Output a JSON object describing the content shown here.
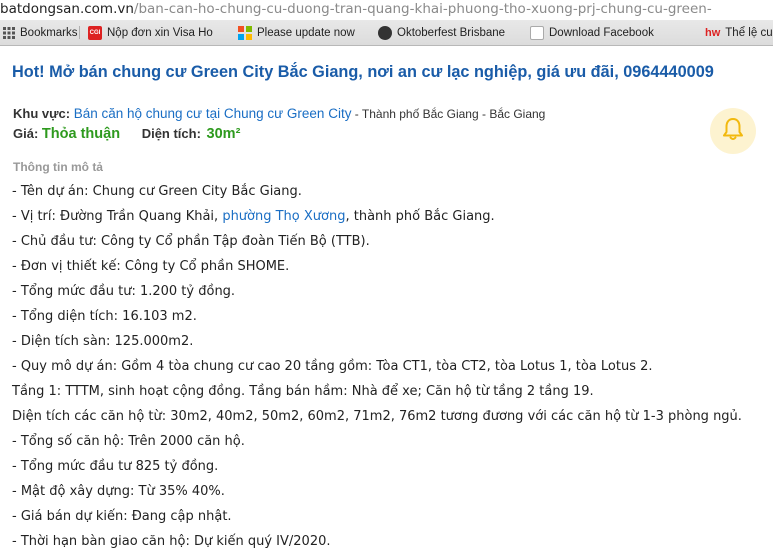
{
  "url": {
    "domain": "batdongsan.com.vn",
    "path": "/ban-can-ho-chung-cu-duong-tran-quang-khai-phuong-tho-xuong-prj-chung-cu-green-"
  },
  "bookmarks": [
    {
      "label": "Bookmarks",
      "icon": "grid-icon"
    },
    {
      "label": "Nộp đơn xin Visa Ho",
      "icon": "cgi-icon"
    },
    {
      "label": "Please update now",
      "icon": "windows-icon"
    },
    {
      "label": "Oktoberfest Brisbane",
      "icon": "oktoberfest-icon"
    },
    {
      "label": "Download Facebook",
      "icon": "facebook-download-icon"
    },
    {
      "label": "Thể lệ cu",
      "icon": "hw-icon"
    }
  ],
  "listing": {
    "title": "Hot! Mở bán chung cư Green City Bắc Giang, nơi an cư lạc nghiệp, giá ưu đãi, 0964440009",
    "area_label": "Khu vực:",
    "area_link": "Bán căn hộ chung cư tại Chung cư Green City",
    "area_rest": " - Thành phố Bắc Giang - Bắc Giang",
    "price_label": "Giá:",
    "price_value": "Thỏa thuận",
    "size_label": "Diện tích:",
    "size_value": "30m²",
    "section_heading": "Thông tin mô tả"
  },
  "description": {
    "lines": [
      {
        "text": "- Tên dự án: Chung cư Green City Bắc Giang."
      },
      {
        "before": "- Vị trí: Đường Trần Quang Khải, ",
        "link": "phường Thọ Xương",
        "after": ", thành phố Bắc Giang."
      },
      {
        "text": "- Chủ đầu tư: Công ty Cổ phần Tập đoàn Tiến Bộ (TTB)."
      },
      {
        "text": "- Đơn vị thiết kế: Công ty Cổ phần SHOME."
      },
      {
        "text": "- Tổng mức đầu tư: 1.200 tỷ đồng."
      },
      {
        "text": "- Tổng diện tích: 16.103 m2."
      },
      {
        "text": "- Diện tích sàn: 125.000m2."
      },
      {
        "text": "- Quy mô dự án: Gồm 4 tòa chung cư cao 20 tầng gồm: Tòa CT1, tòa CT2, tòa Lotus 1, tòa Lotus 2."
      },
      {
        "text": "Tầng 1: TTTM, sinh hoạt cộng đồng. Tầng bán hầm: Nhà để xe; Căn hộ từ tầng 2 tầng 19."
      },
      {
        "text": "Diện tích các căn hộ từ: 30m2, 40m2, 50m2, 60m2, 71m2, 76m2 tương đương với các căn hộ từ 1-3 phòng ngủ."
      },
      {
        "text": "- Tổng số căn hộ: Trên 2000 căn hộ."
      },
      {
        "text": "- Tổng mức đầu tư 825 tỷ đồng."
      },
      {
        "text": "- Mật độ xây dựng: Từ 35% 40%."
      },
      {
        "text": "- Giá bán dự kiến: Đang cập nhật."
      },
      {
        "text": "- Thời hạn bàn giao căn hộ: Dự kiến quý IV/2020."
      }
    ]
  },
  "colors": {
    "title": "#1a5ca8",
    "link": "#1a6ec4",
    "price_green": "#2e9a1e",
    "bell_bg": "#fdf3d0",
    "bell": "#f2b90f"
  }
}
